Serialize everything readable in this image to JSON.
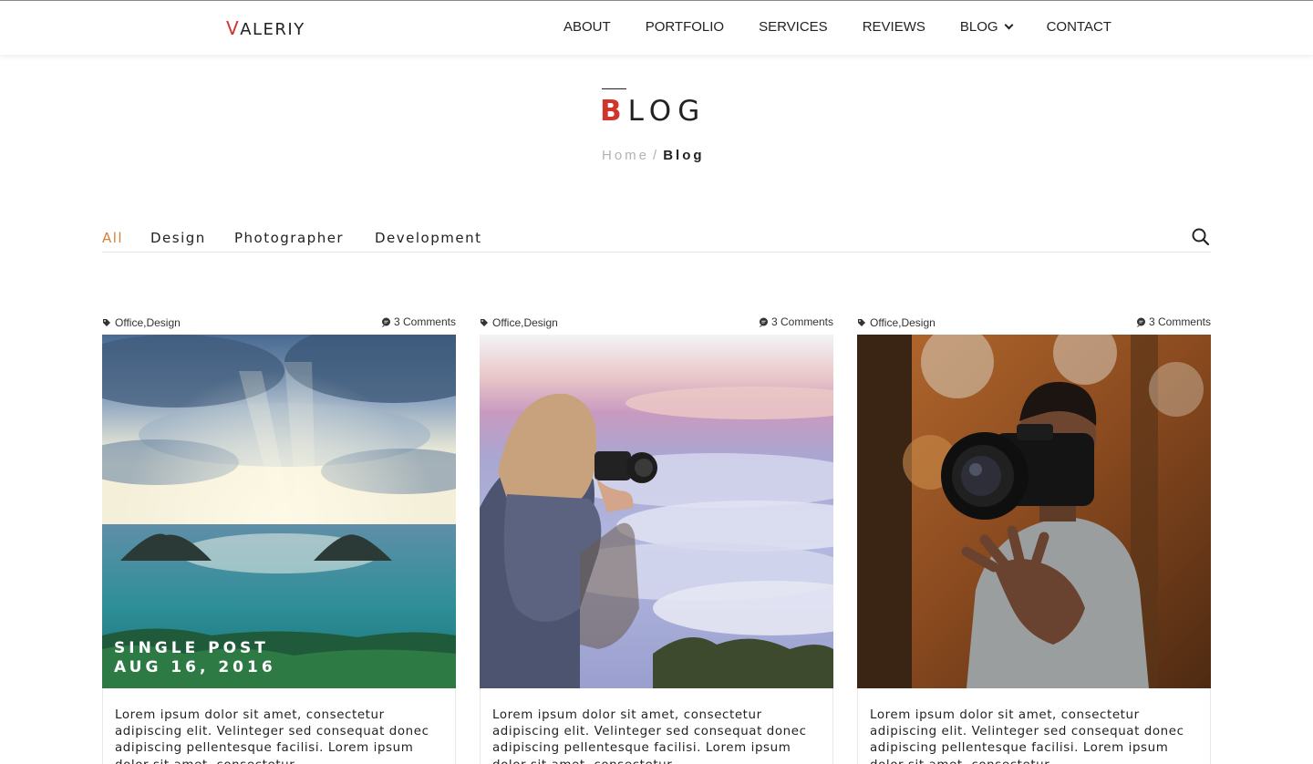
{
  "header": {
    "logo_first": "V",
    "logo_rest": "ALERIY",
    "nav": [
      {
        "label": "ABOUT"
      },
      {
        "label": "PORTFOLIO"
      },
      {
        "label": "SERVICES"
      },
      {
        "label": "REVIEWS"
      },
      {
        "label": "BLOG"
      },
      {
        "label": "CONTACT"
      }
    ]
  },
  "page": {
    "title_first": "B",
    "title_rest": "LOG",
    "breadcrumb": {
      "home": "Home",
      "separator": "/",
      "current": "Blog"
    }
  },
  "filters": [
    {
      "label": "All",
      "active": true
    },
    {
      "label": "Design",
      "active": false
    },
    {
      "label": "Photographer",
      "active": false
    },
    {
      "label": "Development",
      "active": false
    }
  ],
  "colors": {
    "accent_red": "#d0342c",
    "accent_orange": "#d2803a"
  },
  "posts": [
    {
      "tag1": "Office",
      "tag2": "Design",
      "comments": "3 Comments",
      "overlay_title": "SINGLE POST",
      "overlay_date": "AUG 16, 2016",
      "excerpt": "Lorem ipsum dolor sit amet, consectetur adipiscing elit. Velinteger sed consequat donec adipiscing pellentesque facilisi. Lorem ipsum dolor sit amet, consectetur"
    },
    {
      "tag1": "Office",
      "tag2": "Design",
      "comments": "3 Comments",
      "excerpt": "Lorem ipsum dolor sit amet, consectetur adipiscing elit. Velinteger sed consequat donec adipiscing pellentesque facilisi. Lorem ipsum dolor sit amet, consectetur"
    },
    {
      "tag1": "Office",
      "tag2": "Design",
      "comments": "3 Comments",
      "excerpt": "Lorem ipsum dolor sit amet, consectetur adipiscing elit. Velinteger sed consequat donec adipiscing pellentesque facilisi. Lorem ipsum dolor sit amet, consectetur"
    }
  ]
}
